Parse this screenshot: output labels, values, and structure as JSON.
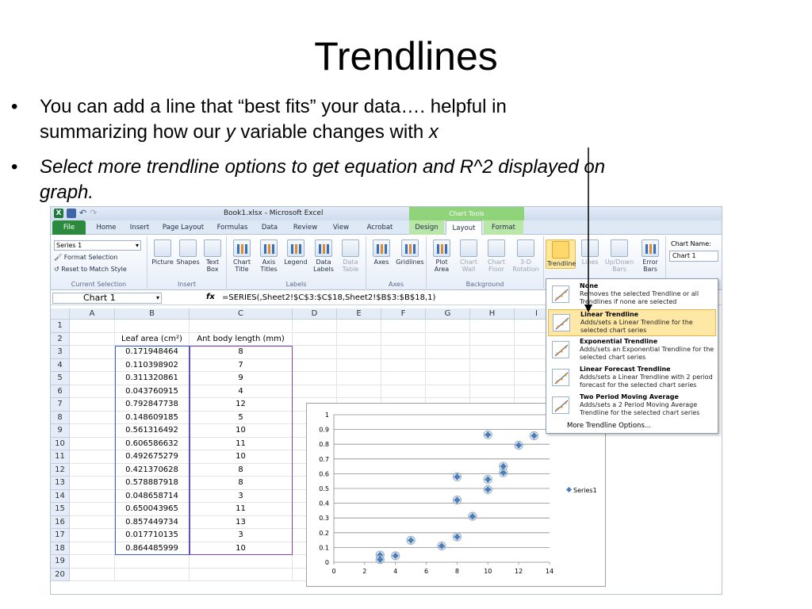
{
  "slide": {
    "title": "Trendlines",
    "bullet1_a": "You can add a line that “best fits” your data…. helpful in",
    "bullet1_b_pre": "summarizing how our ",
    "bullet1_b_y": "y",
    "bullet1_b_mid": " variable changes with ",
    "bullet1_b_x": "x",
    "bullet2_a": "Select more trendline options to get equation and R^2 displayed on",
    "bullet2_b": "graph.",
    "bullet_glyph": "•"
  },
  "window": {
    "title": "Book1.xlsx - Microsoft Excel",
    "chart_tools": "Chart Tools"
  },
  "tabs": [
    "File",
    "Home",
    "Insert",
    "Page Layout",
    "Formulas",
    "Data",
    "Review",
    "View",
    "Acrobat",
    "Design",
    "Layout",
    "Format"
  ],
  "ribbon": {
    "series_select": "Series 1",
    "format_selection": "Format Selection",
    "reset_style": "Reset to Match Style",
    "groups": {
      "current_selection": "Current Selection",
      "insert": "Insert",
      "labels": "Labels",
      "axes": "Axes",
      "background": "Background"
    },
    "buttons": {
      "picture": "Picture",
      "shapes": "Shapes",
      "text_box": "Text Box",
      "chart_title": "Chart Title",
      "axis_titles": "Axis Titles",
      "legend": "Legend",
      "data_labels": "Data Labels",
      "data_table": "Data Table",
      "axes": "Axes",
      "gridlines": "Gridlines",
      "plot_area": "Plot Area",
      "chart_wall": "Chart Wall",
      "chart_floor": "Chart Floor",
      "rotation": "3-D Rotation",
      "trendline": "Trendline",
      "lines": "Lines",
      "updown": "Up/Down Bars",
      "error_bars": "Error Bars"
    },
    "chart_name_label": "Chart Name:",
    "chart_name_value": "Chart 1"
  },
  "formula_bar": {
    "name_box": "Chart 1",
    "fx": "fx",
    "formula": "=SERIES(,Sheet2!$C$3:$C$18,Sheet2!$B$3:$B$18,1)"
  },
  "columns": [
    "A",
    "B",
    "C",
    "D",
    "E",
    "F",
    "G",
    "H",
    "I"
  ],
  "rows": [
    "1",
    "2",
    "3",
    "4",
    "5",
    "6",
    "7",
    "8",
    "9",
    "10",
    "11",
    "12",
    "13",
    "14",
    "15",
    "16",
    "17",
    "18",
    "19",
    "20"
  ],
  "table": {
    "header_b": "Leaf area (cm²)",
    "header_c": "Ant body length (mm)",
    "leaf_area": [
      "0.171948464",
      "0.110398902",
      "0.311320861",
      "0.043760915",
      "0.792847738",
      "0.148609185",
      "0.561316492",
      "0.606586632",
      "0.492675279",
      "0.421370628",
      "0.578887918",
      "0.048658714",
      "0.650043965",
      "0.857449734",
      "0.017710135",
      "0.864485999"
    ],
    "ant_length": [
      "8",
      "7",
      "9",
      "4",
      "12",
      "5",
      "10",
      "11",
      "10",
      "8",
      "8",
      "3",
      "11",
      "13",
      "3",
      "10"
    ]
  },
  "trendline_menu": [
    {
      "title": "None",
      "desc": "Removes the selected Trendline or all Trendlines if none are selected"
    },
    {
      "title": "Linear Trendline",
      "desc": "Adds/sets a Linear Trendline for the selected chart series"
    },
    {
      "title": "Exponential Trendline",
      "desc": "Adds/sets an Exponential Trendline for the selected chart series"
    },
    {
      "title": "Linear Forecast Trendline",
      "desc": "Adds/sets a Linear Trendline with 2 period forecast for the selected chart series"
    },
    {
      "title": "Two Period Moving Average",
      "desc": "Adds/sets a 2 Period Moving Average Trendline for the selected chart series"
    }
  ],
  "more_options": "More Trendline Options...",
  "chart_data": {
    "type": "scatter",
    "title": "",
    "xlabel": "",
    "ylabel": "",
    "xlim": [
      0,
      14
    ],
    "ylim": [
      0,
      1
    ],
    "xticks": [
      "0",
      "2",
      "4",
      "6",
      "8",
      "10",
      "12",
      "14"
    ],
    "yticks": [
      "0",
      "0.1",
      "0.2",
      "0.3",
      "0.4",
      "0.5",
      "0.6",
      "0.7",
      "0.8",
      "0.9",
      "1"
    ],
    "series": [
      {
        "name": "Series1",
        "x": [
          8,
          7,
          9,
          4,
          12,
          5,
          10,
          11,
          10,
          8,
          8,
          3,
          11,
          13,
          3,
          10
        ],
        "y": [
          0.171948464,
          0.110398902,
          0.311320861,
          0.043760915,
          0.792847738,
          0.148609185,
          0.561316492,
          0.606586632,
          0.492675279,
          0.421370628,
          0.578887918,
          0.048658714,
          0.650043965,
          0.857449734,
          0.017710135,
          0.864485999
        ]
      }
    ],
    "grid": true,
    "legend": "right",
    "marker_color": "#4a7ebb"
  }
}
